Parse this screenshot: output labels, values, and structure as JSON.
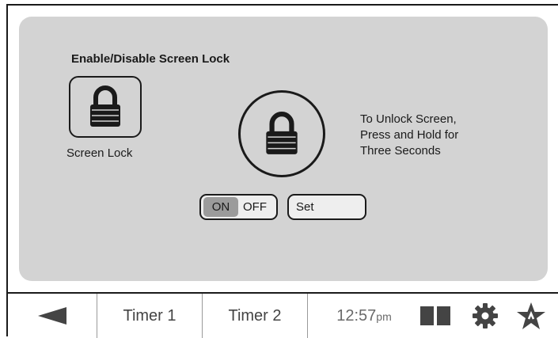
{
  "screen_lock": {
    "title": "Enable/Disable Screen Lock",
    "tile_label": "Screen Lock",
    "instructions": [
      "To Unlock Screen,",
      "Press and Hold for",
      "Three Seconds"
    ],
    "toggle": {
      "on_label": "ON",
      "off_label": "OFF",
      "selected": "ON"
    },
    "set_label": "Set"
  },
  "navbar": {
    "back_icon": "back-arrow-icon",
    "timer1_label": "Timer 1",
    "timer2_label": "Timer 2",
    "time": "12:57",
    "ampm": "pm",
    "icons": [
      "split-panel-icon",
      "gear-icon",
      "star-icon"
    ]
  },
  "colors": {
    "panel": "#d3d3d3",
    "toggle_selected": "#9b9b9b",
    "ink": "#1a1a1a",
    "nav_text": "#444444"
  }
}
